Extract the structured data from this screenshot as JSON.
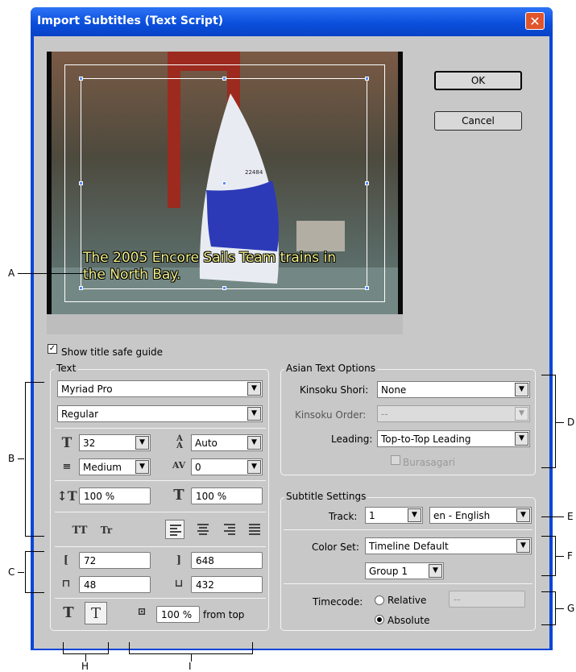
{
  "dialog": {
    "title": "Import Subtitles (Text Script)",
    "close_glyph": "✕",
    "ok_label": "OK",
    "cancel_label": "Cancel"
  },
  "preview": {
    "subtitle_text": "The 2005 Encore Sails Team trains in\nthe North Bay.",
    "sail_number": "22484"
  },
  "show_title_safe": {
    "label": "Show title safe guide",
    "checked": true
  },
  "text_group": {
    "label": "Text",
    "font_family": "Myriad Pro",
    "font_style": "Regular",
    "font_size": "32",
    "leading": "Auto",
    "stroke_weight": "Medium",
    "tracking": "0",
    "vertical_scale": "100 %",
    "horizontal_scale": "100 %",
    "all_caps_glyph": "TT",
    "small_caps_glyph": "Tr",
    "margin_left": "72",
    "margin_right": "648",
    "margin_top": "48",
    "margin_bottom": "432",
    "vertical_glyph": "T",
    "horizontal_glyph": "T",
    "position_value": "100 %",
    "position_suffix": "from top"
  },
  "asian_group": {
    "label": "Asian Text Options",
    "kinsoku_shori_label": "Kinsoku Shori:",
    "kinsoku_shori_value": "None",
    "kinsoku_order_label": "Kinsoku Order:",
    "kinsoku_order_value": "--",
    "leading_label": "Leading:",
    "leading_value": "Top-to-Top Leading",
    "burasagari_label": "Burasagari"
  },
  "subtitle_group": {
    "label": "Subtitle Settings",
    "track_label": "Track:",
    "track_value": "1",
    "language_value": "en - English",
    "color_set_label": "Color Set:",
    "color_set_value": "Timeline Default",
    "group_value": "Group 1",
    "timecode_label": "Timecode:",
    "relative_label": "Relative",
    "relative_value": "--",
    "absolute_label": "Absolute"
  },
  "callouts": {
    "a": "A",
    "b": "B",
    "c": "C",
    "d": "D",
    "e": "E",
    "f": "F",
    "g": "G",
    "h": "H",
    "i": "I"
  },
  "icons": [
    "close-icon",
    "checkmark-icon",
    "dropdown-arrow-icon",
    "font-size-icon",
    "leading-icon",
    "stroke-icon",
    "tracking-icon",
    "vertical-scale-icon",
    "horizontal-scale-icon",
    "align-left-icon",
    "align-center-icon",
    "align-right-icon",
    "justify-icon",
    "margin-icon",
    "vertical-text-icon",
    "horizontal-text-icon",
    "position-icon"
  ],
  "colors": {
    "title_bar": "#0a46d8",
    "dialog_bg": "#c8c8c8",
    "subtitle_text": "#f2ef88",
    "close_button": "#e1552d"
  }
}
